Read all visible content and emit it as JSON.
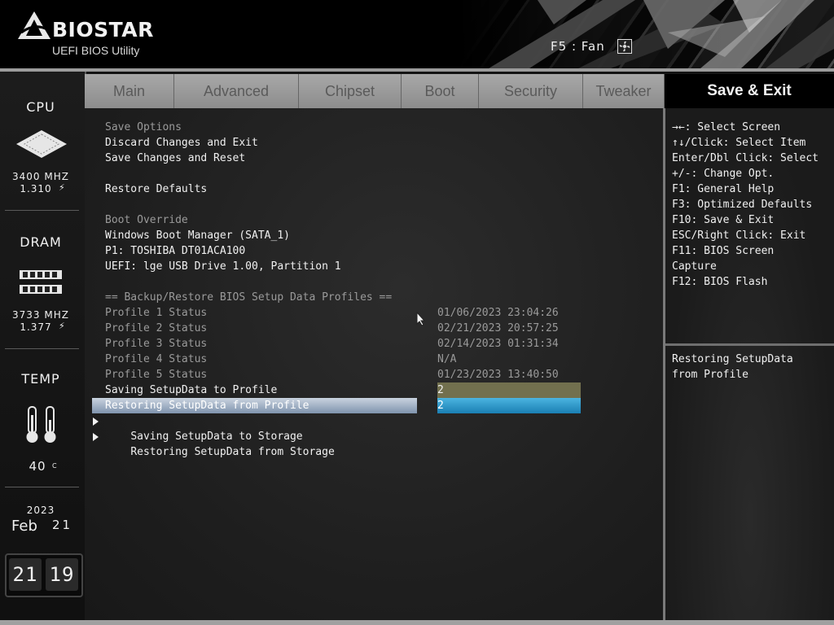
{
  "header": {
    "brand": "BIOSTAR",
    "subtitle": "UEFI BIOS Utility",
    "fan_label": "F5 : Fan"
  },
  "status": {
    "cpu": {
      "label": "CPU",
      "freq": "3400 MHZ",
      "volt": "1.310"
    },
    "dram": {
      "label": "DRAM",
      "freq": "3733 MHZ",
      "volt": "1.377"
    },
    "temp": {
      "label": "TEMP",
      "value": "40",
      "unit": "C"
    },
    "date": {
      "year": "2023",
      "month": "Feb",
      "day": "21"
    },
    "clock": {
      "hour": "21",
      "minute": "19"
    }
  },
  "tabs": [
    {
      "label": "Main"
    },
    {
      "label": "Advanced"
    },
    {
      "label": "Chipset"
    },
    {
      "label": "Boot"
    },
    {
      "label": "Security"
    },
    {
      "label": "Tweaker"
    },
    {
      "label": "Save & Exit",
      "active": true
    }
  ],
  "main": {
    "save_options_header": "Save Options",
    "discard_exit": "Discard Changes and Exit",
    "save_reset": "Save Changes and Reset",
    "restore_defaults": "Restore Defaults",
    "boot_override_header": "Boot Override",
    "boot_items": [
      "Windows Boot Manager (SATA_1)",
      "P1: TOSHIBA DT01ACA100",
      "UEFI: lge USB Drive 1.00, Partition 1"
    ],
    "profiles_header": "== Backup/Restore BIOS Setup Data Profiles ==",
    "profiles": [
      {
        "label": "Profile 1 Status",
        "value": "01/06/2023 23:04:26"
      },
      {
        "label": "Profile 2 Status",
        "value": "02/21/2023 20:57:25"
      },
      {
        "label": "Profile 3 Status",
        "value": "02/14/2023 01:31:34"
      },
      {
        "label": "Profile 4 Status",
        "value": "N/A"
      },
      {
        "label": "Profile 5 Status",
        "value": "01/23/2023 13:40:50"
      }
    ],
    "saving_profile": {
      "label": "Saving SetupData to Profile",
      "value": "2"
    },
    "restoring_profile": {
      "label": "Restoring SetupData from Profile",
      "value": "2"
    },
    "saving_storage": "Saving SetupData to Storage",
    "restoring_storage": "Restoring SetupData from Storage"
  },
  "help": {
    "keys": [
      "→←: Select Screen",
      "↑↓/Click: Select Item",
      "Enter/Dbl Click: Select",
      "+/-: Change Opt.",
      "F1: General Help",
      "F3: Optimized Defaults",
      "F10: Save & Exit",
      "ESC/Right Click: Exit",
      "F11: BIOS Screen",
      "Capture",
      "F12: BIOS Flash"
    ],
    "description": [
      "Restoring SetupData",
      "from Profile"
    ]
  },
  "colors": {
    "selected_row": "#9fb0c6",
    "option_box": "#72704e",
    "selected_option_box": "#2a96cc",
    "tab_bg": "#9a9a9a"
  }
}
